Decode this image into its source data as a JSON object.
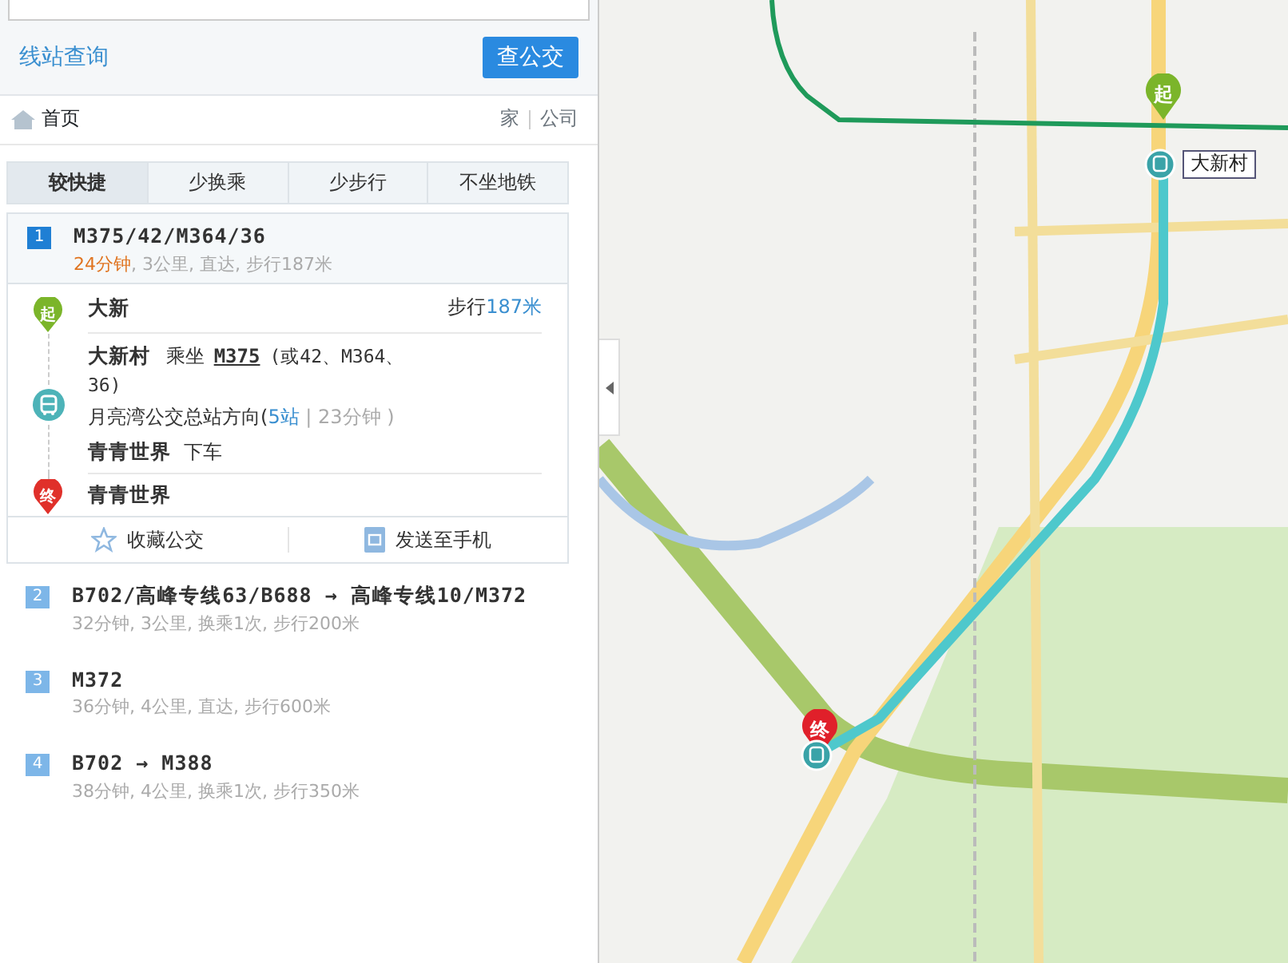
{
  "search": {
    "link": "线站查询",
    "button": "查公交"
  },
  "breadcrumb": {
    "home": "首页",
    "shortcuts": [
      "家",
      "公司"
    ]
  },
  "tabs": [
    {
      "label": "较快捷",
      "selected": true
    },
    {
      "label": "少换乘",
      "selected": false
    },
    {
      "label": "少步行",
      "selected": false
    },
    {
      "label": "不坐地铁",
      "selected": false
    }
  ],
  "routes": [
    {
      "number": "1",
      "title": "M375/42/M364/36",
      "duration": "24分钟",
      "summary": ", 3公里, 直达, 步行187米",
      "expanded": true,
      "steps": [
        {
          "kind": "start",
          "badge": "起",
          "stop": "大新",
          "walk_label": "步行",
          "walk_distance": "187米"
        },
        {
          "kind": "bus",
          "stop": "大新村",
          "action": "乘坐",
          "line": "M375",
          "alternatives": "(或42、M364、36)",
          "direction": "月亮湾公交总站方向(",
          "stations": "5站",
          "time": "| 23分钟 )",
          "alight_stop": "青青世界",
          "alight_action": "下车"
        },
        {
          "kind": "end",
          "badge": "终",
          "stop": "青青世界"
        }
      ],
      "actions": [
        {
          "kind": "star",
          "label": "收藏公交"
        },
        {
          "kind": "phone",
          "label": "发送至手机"
        }
      ]
    },
    {
      "number": "2",
      "title": "B702/高峰专线63/B688 → 高峰专线10/M372",
      "duration": "32分钟",
      "summary": ", 3公里, 换乘1次, 步行200米",
      "expanded": false
    },
    {
      "number": "3",
      "title": "M372",
      "duration": "36分钟",
      "summary": ", 4公里, 直达, 步行600米",
      "expanded": false
    },
    {
      "number": "4",
      "title": "B702 → M388",
      "duration": "38分钟",
      "summary": ", 4公里, 换乘1次, 步行350米",
      "expanded": false
    }
  ],
  "map": {
    "markers": [
      {
        "kind": "start",
        "text": "起"
      },
      {
        "kind": "end",
        "text": "终"
      }
    ],
    "stop_label": "大新村"
  }
}
